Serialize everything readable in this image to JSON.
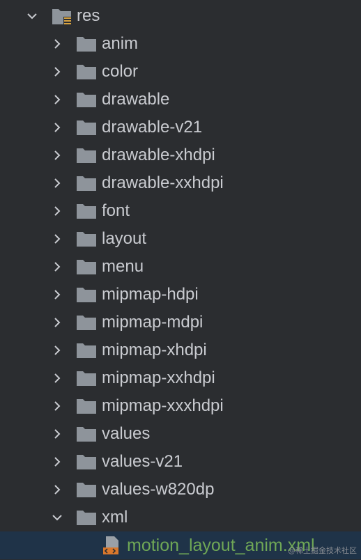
{
  "root": {
    "label": "res",
    "expanded": true
  },
  "folders": [
    {
      "label": "anim",
      "expanded": false
    },
    {
      "label": "color",
      "expanded": false
    },
    {
      "label": "drawable",
      "expanded": false
    },
    {
      "label": "drawable-v21",
      "expanded": false
    },
    {
      "label": "drawable-xhdpi",
      "expanded": false
    },
    {
      "label": "drawable-xxhdpi",
      "expanded": false
    },
    {
      "label": "font",
      "expanded": false
    },
    {
      "label": "layout",
      "expanded": false
    },
    {
      "label": "menu",
      "expanded": false
    },
    {
      "label": "mipmap-hdpi",
      "expanded": false
    },
    {
      "label": "mipmap-mdpi",
      "expanded": false
    },
    {
      "label": "mipmap-xhdpi",
      "expanded": false
    },
    {
      "label": "mipmap-xxhdpi",
      "expanded": false
    },
    {
      "label": "mipmap-xxxhdpi",
      "expanded": false
    },
    {
      "label": "values",
      "expanded": false
    },
    {
      "label": "values-v21",
      "expanded": false
    },
    {
      "label": "values-w820dp",
      "expanded": false
    },
    {
      "label": "xml",
      "expanded": true
    }
  ],
  "selected_file": {
    "label": "motion_layout_anim.xml",
    "icon": "xml-file-icon"
  },
  "watermark": "@稀土掘金技术社区",
  "colors": {
    "background": "#2b2d30",
    "text": "#c9cbd0",
    "folder": "#8e949b",
    "selected_row": "#1f3348",
    "file_text": "#6fa756",
    "xml_badge": "#d9782c"
  }
}
